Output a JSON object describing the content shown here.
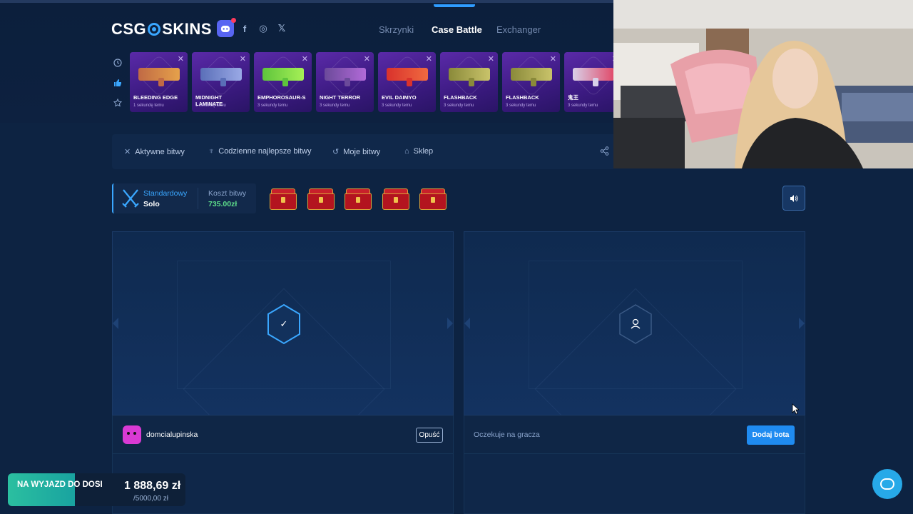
{
  "header": {
    "logo_text": "CSG",
    "logo_text_2": "SKINS",
    "nav": [
      {
        "label": "Skrzynki",
        "active": false
      },
      {
        "label": "Case Battle",
        "active": true
      },
      {
        "label": "Exchanger",
        "active": false
      }
    ],
    "social": {
      "facebook": "f",
      "instagram": "◎",
      "x": "𝕏"
    }
  },
  "live_drops": [
    {
      "name": "BLEEDING EDGE",
      "time": "1 sekundę temu",
      "gun_color": "#c06a45",
      "accent": "#e6a14a"
    },
    {
      "name": "MIDNIGHT LAMINATE",
      "time": "1 sekundę temu",
      "gun_color": "#5a6fb8",
      "accent": "#9aa9e6"
    },
    {
      "name": "EMPHOROSAUR-S",
      "time": "3 sekundy temu",
      "gun_color": "#5ec43c",
      "accent": "#a6f056"
    },
    {
      "name": "NIGHT TERROR",
      "time": "3 sekundy temu",
      "gun_color": "#6b4a9a",
      "accent": "#b26ad8"
    },
    {
      "name": "EVIL DAIMYO",
      "time": "3 sekundy temu",
      "gun_color": "#d9322c",
      "accent": "#f06a40"
    },
    {
      "name": "FLASHBACK",
      "time": "3 sekundy temu",
      "gun_color": "#8a8a3a",
      "accent": "#c9c36a"
    },
    {
      "name": "FLASHBACK",
      "time": "3 sekundy temu",
      "gun_color": "#8a8a3a",
      "accent": "#c9c36a"
    },
    {
      "name": "鬼王",
      "time": "3 sekundy temu",
      "gun_color": "#d8d0e8",
      "accent": "#e04a6a"
    }
  ],
  "tabs": [
    {
      "label": "Aktywne bitwy",
      "icon": "crossed-swords-icon",
      "glyph": "✕"
    },
    {
      "label": "Codzienne najlepsze bitwy",
      "icon": "trophy-icon",
      "glyph": "♆"
    },
    {
      "label": "Moje bitwy",
      "icon": "history-icon",
      "glyph": "↺"
    },
    {
      "label": "Sklep",
      "icon": "basket-icon",
      "glyph": "⌂"
    }
  ],
  "battle": {
    "mode_label": "Standardowy",
    "mode_sub": "Solo",
    "cost_label": "Koszt bitwy",
    "cost_value": "735.00zł",
    "cases_count": 5
  },
  "players": {
    "player1_name": "domcialupinska",
    "leave_label": "Opuść",
    "waiting_label": "Oczekuje na gracza",
    "add_bot_label": "Dodaj bota"
  },
  "goal": {
    "title": "NA WYJAZD DO DOSI",
    "current": "1 888,69 zł",
    "target": "/5000,00 zł",
    "progress": 0.378
  },
  "colors": {
    "accent": "#3aa7ff",
    "background": "#0d2342",
    "cost_green": "#5ddc8a",
    "button_blue": "#1f8bf0"
  }
}
